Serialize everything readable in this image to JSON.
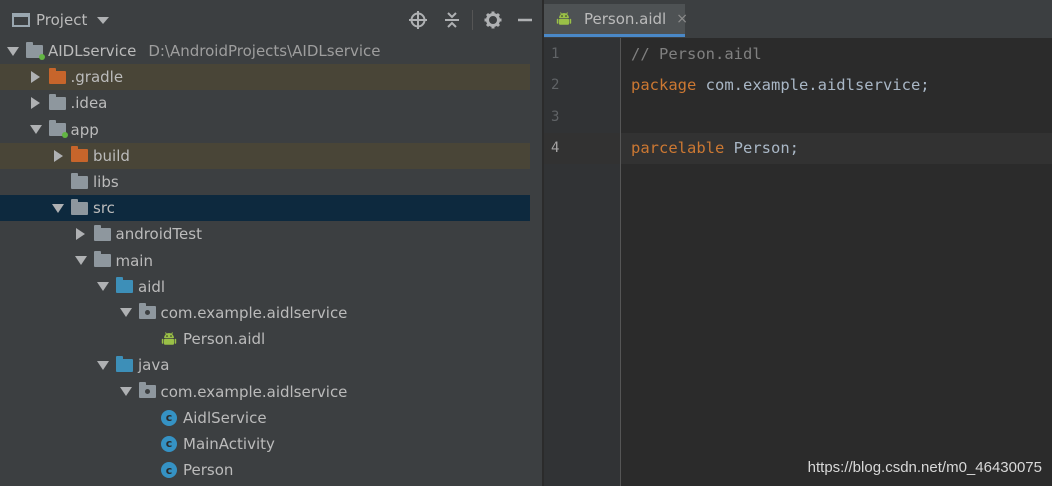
{
  "panel": {
    "title": "Project",
    "toolbar_icons": [
      "locate-icon",
      "collapse-all-icon",
      "gear-icon",
      "hide-icon"
    ]
  },
  "tree": [
    {
      "label": "AIDLservice",
      "path": "D:\\AndroidProjects\\AIDLservice",
      "indent": 0,
      "arrow": "down",
      "icon": "module-folder"
    },
    {
      "label": ".gradle",
      "indent": 1,
      "arrow": "right",
      "icon": "folder-orange",
      "state": "excluded"
    },
    {
      "label": ".idea",
      "indent": 1,
      "arrow": "right",
      "icon": "folder-grey"
    },
    {
      "label": "app",
      "indent": 1,
      "arrow": "down",
      "icon": "module-folder"
    },
    {
      "label": "build",
      "indent": 2,
      "arrow": "right",
      "icon": "folder-orange",
      "state": "excluded"
    },
    {
      "label": "libs",
      "indent": 2,
      "arrow": "none",
      "icon": "folder-grey"
    },
    {
      "label": "src",
      "indent": 2,
      "arrow": "down",
      "icon": "folder-grey",
      "state": "selected"
    },
    {
      "label": "androidTest",
      "indent": 3,
      "arrow": "right",
      "icon": "folder-grey"
    },
    {
      "label": "main",
      "indent": 3,
      "arrow": "down",
      "icon": "folder-grey"
    },
    {
      "label": "aidl",
      "indent": 4,
      "arrow": "down",
      "icon": "folder-blue"
    },
    {
      "label": "com.example.aidlservice",
      "indent": 5,
      "arrow": "down",
      "icon": "package"
    },
    {
      "label": "Person.aidl",
      "indent": 6,
      "arrow": "none",
      "icon": "android-file"
    },
    {
      "label": "java",
      "indent": 4,
      "arrow": "down",
      "icon": "folder-blue"
    },
    {
      "label": "com.example.aidlservice",
      "indent": 5,
      "arrow": "down",
      "icon": "package"
    },
    {
      "label": "AidlService",
      "indent": 6,
      "arrow": "none",
      "icon": "class"
    },
    {
      "label": "MainActivity",
      "indent": 6,
      "arrow": "none",
      "icon": "class"
    },
    {
      "label": "Person",
      "indent": 6,
      "arrow": "none",
      "icon": "class"
    }
  ],
  "editor": {
    "tab_label": "Person.aidl",
    "tab_close": "×",
    "lines": [
      {
        "num": "1",
        "parts": [
          {
            "t": "// Person.aidl",
            "c": "cmt"
          }
        ]
      },
      {
        "num": "2",
        "parts": [
          {
            "t": "package",
            "c": "kw"
          },
          {
            "t": " com.example.aidlservice;",
            "c": ""
          }
        ]
      },
      {
        "num": "3",
        "parts": []
      },
      {
        "num": "4",
        "parts": [
          {
            "t": "parcelable",
            "c": "kw"
          },
          {
            "t": " Person;",
            "c": ""
          }
        ],
        "current": true
      }
    ]
  },
  "watermark": "https://blog.csdn.net/m0_46430075",
  "colors": {
    "keyword": "#cc7832",
    "comment": "#808080",
    "text": "#a9b7c6",
    "selection": "#0d293e",
    "excluded": "#494537"
  }
}
